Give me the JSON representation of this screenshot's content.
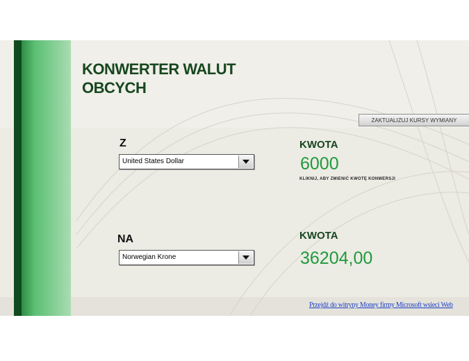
{
  "title": {
    "line1": "KONWERTER WALUT",
    "line2": "OBCYCH"
  },
  "update_button": {
    "label": "ZAKTUALIZUJ KURSY WYMIANY"
  },
  "from": {
    "label": "Z",
    "currency": "United States Dollar",
    "amount_label": "KWOTA",
    "amount": "6000",
    "hint": "KLIKNIJ, ABY ZMIENIĆ KWOTĘ KONWERSJI"
  },
  "to": {
    "label": "NA",
    "currency": "Norwegian Krone",
    "amount_label": "KWOTA",
    "amount": "36204,00"
  },
  "footer": {
    "link": "Przejdź do witryny Money firmy Microsoft wsieci Web"
  },
  "colors": {
    "title": "#17461f",
    "amount": "#1f9a3c",
    "strip_dark": "#114a1f",
    "strip_light": "#a9dcb2",
    "link": "#1a3ec8"
  }
}
